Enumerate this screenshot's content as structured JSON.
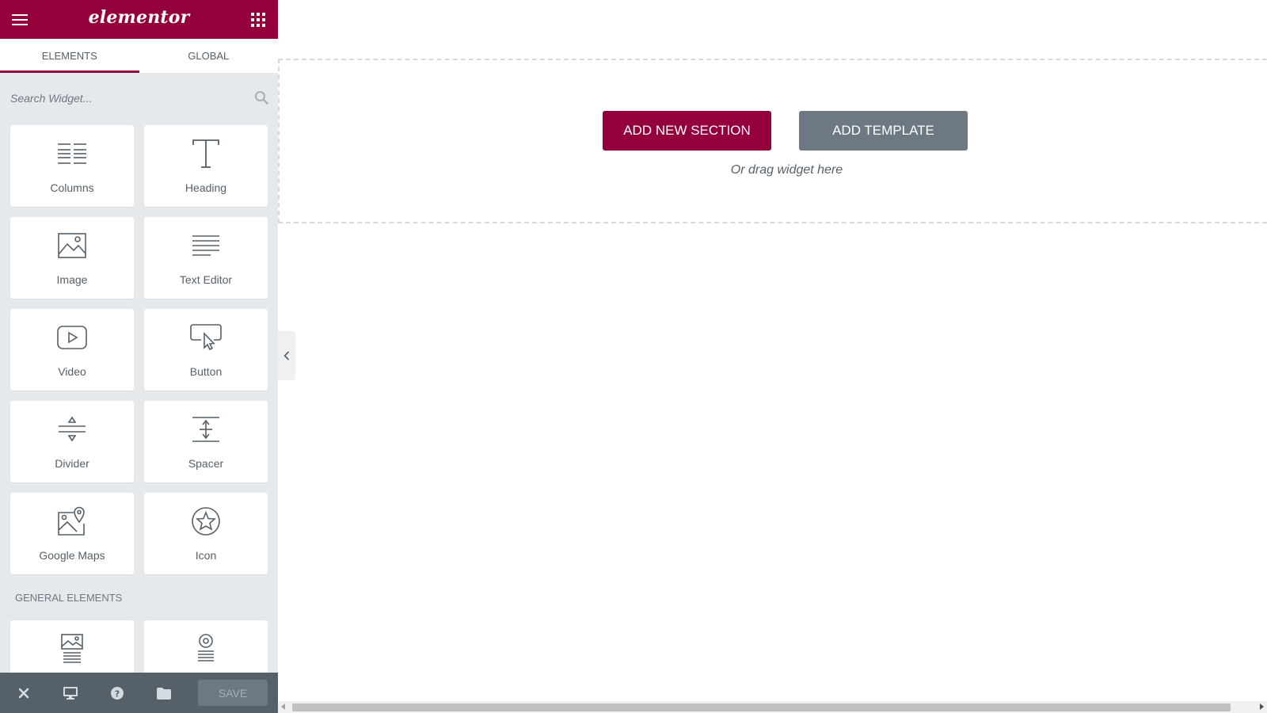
{
  "brand": {
    "logo_text": "elementor",
    "primary_color": "#93003c",
    "footer_color": "#556068"
  },
  "header": {
    "menu_icon": "hamburger-icon",
    "apps_icon": "grid-icon"
  },
  "tabs": [
    {
      "label": "ELEMENTS",
      "active": true
    },
    {
      "label": "GLOBAL",
      "active": false
    }
  ],
  "search": {
    "placeholder": "Search Widget...",
    "value": "",
    "icon": "search-icon"
  },
  "widgets_basic": [
    {
      "label": "Columns",
      "icon": "columns-icon"
    },
    {
      "label": "Heading",
      "icon": "heading-icon"
    },
    {
      "label": "Image",
      "icon": "image-icon"
    },
    {
      "label": "Text Editor",
      "icon": "text-editor-icon"
    },
    {
      "label": "Video",
      "icon": "video-icon"
    },
    {
      "label": "Button",
      "icon": "button-icon"
    },
    {
      "label": "Divider",
      "icon": "divider-icon"
    },
    {
      "label": "Spacer",
      "icon": "spacer-icon"
    },
    {
      "label": "Google Maps",
      "icon": "google-maps-icon"
    },
    {
      "label": "Icon",
      "icon": "star-icon"
    }
  ],
  "general_section": {
    "title": "GENERAL ELEMENTS"
  },
  "widgets_general": [
    {
      "label": "",
      "icon": "image-box-icon"
    },
    {
      "label": "",
      "icon": "icon-box-icon"
    }
  ],
  "footer": {
    "icons": [
      "close-icon",
      "responsive-mode-icon",
      "help-icon",
      "folder-icon"
    ],
    "save_label": "SAVE"
  },
  "canvas": {
    "add_section_label": "ADD NEW SECTION",
    "add_template_label": "ADD TEMPLATE",
    "drag_hint": "Or drag widget here"
  }
}
